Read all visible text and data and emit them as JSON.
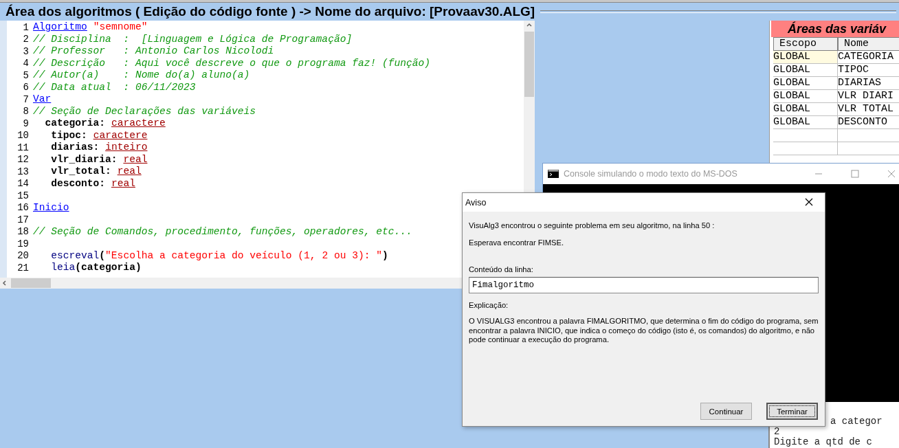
{
  "editor": {
    "title": "Área dos algoritmos ( Edição do código fonte ) -> Nome do arquivo: [Provaav30.ALG]",
    "lines": [
      {
        "number": "1",
        "tokens": [
          {
            "kind": "keyword",
            "text": "Algoritmo"
          },
          {
            "kind": "string",
            "text": "\"semnome\"",
            "gap": true
          }
        ]
      },
      {
        "number": "2",
        "tokens": [
          {
            "kind": "comment",
            "text": "// Disciplina  :  [Linguagem e Lógica de Programação]"
          }
        ]
      },
      {
        "number": "3",
        "tokens": [
          {
            "kind": "comment",
            "text": "// Professor   : Antonio Carlos Nicolodi"
          }
        ]
      },
      {
        "number": "4",
        "tokens": [
          {
            "kind": "comment",
            "text": "// Descrição   : Aqui você descreve o que o programa faz! (função)"
          }
        ]
      },
      {
        "number": "5",
        "tokens": [
          {
            "kind": "comment",
            "text": "// Autor(a)    : Nome do(a) aluno(a)"
          }
        ]
      },
      {
        "number": "6",
        "tokens": [
          {
            "kind": "comment",
            "text": "// Data atual  : 06/11/2023"
          }
        ]
      },
      {
        "number": "7",
        "tokens": [
          {
            "kind": "keyword",
            "text": "Var"
          }
        ]
      },
      {
        "number": "8",
        "tokens": [
          {
            "kind": "comment",
            "text": "// Seção de Declarações das variáveis"
          }
        ]
      },
      {
        "number": "9",
        "tokens": [
          {
            "kind": "ident",
            "text": "  categoria:"
          },
          {
            "kind": "type",
            "text": "caractere",
            "gap": true
          }
        ]
      },
      {
        "number": "10",
        "tokens": [
          {
            "kind": "ident",
            "text": "   tipoc:"
          },
          {
            "kind": "type",
            "text": "caractere",
            "gap": true
          }
        ]
      },
      {
        "number": "11",
        "tokens": [
          {
            "kind": "ident",
            "text": "   diarias:"
          },
          {
            "kind": "type",
            "text": "inteiro",
            "gap": true
          }
        ]
      },
      {
        "number": "12",
        "tokens": [
          {
            "kind": "ident",
            "text": "   vlr_diaria:"
          },
          {
            "kind": "type",
            "text": "real",
            "gap": true
          }
        ]
      },
      {
        "number": "13",
        "tokens": [
          {
            "kind": "ident",
            "text": "   vlr_total:"
          },
          {
            "kind": "type",
            "text": "real",
            "gap": true
          }
        ]
      },
      {
        "number": "14",
        "tokens": [
          {
            "kind": "ident",
            "text": "   desconto:"
          },
          {
            "kind": "type",
            "text": "real",
            "gap": true
          }
        ]
      },
      {
        "number": "15"
      },
      {
        "number": "16",
        "tokens": [
          {
            "kind": "keyword",
            "text": "Inicio"
          }
        ]
      },
      {
        "number": "17"
      },
      {
        "number": "18",
        "tokens": [
          {
            "kind": "comment",
            "text": "// Seção de Comandos, procedimento, funções, operadores, etc..."
          }
        ]
      },
      {
        "number": "19"
      },
      {
        "number": "20",
        "tokens": [
          {
            "kind": "builtin",
            "text": "   escreval"
          },
          {
            "kind": "ident",
            "text": "("
          },
          {
            "kind": "string",
            "text": "\"Escolha a categoria do veículo (1, 2 ou 3): \""
          },
          {
            "kind": "ident",
            "text": ")"
          }
        ]
      },
      {
        "number": "21",
        "tokens": [
          {
            "kind": "builtin",
            "text": "   leia"
          },
          {
            "kind": "ident",
            "text": "(categoria)"
          }
        ]
      }
    ]
  },
  "variables": {
    "title": "Áreas das variáv",
    "columns": [
      "Escopo",
      "Nome"
    ],
    "rows": [
      {
        "cells": [
          "GLOBAL",
          "CATEGORIA"
        ],
        "selected": true
      },
      {
        "cells": [
          "GLOBAL",
          "TIPOC"
        ],
        "selected": false
      },
      {
        "cells": [
          "GLOBAL",
          "DIARIAS"
        ],
        "selected": false
      },
      {
        "cells": [
          "GLOBAL",
          "VLR DIARI"
        ],
        "selected": false
      },
      {
        "cells": [
          "GLOBAL",
          "VLR TOTAL"
        ],
        "selected": false
      },
      {
        "cells": [
          "GLOBAL",
          "DESCONTO"
        ],
        "selected": false
      }
    ]
  },
  "console": {
    "title": "Console simulando o modo texto do MS-DOS"
  },
  "output": [
    {
      "text": "a categor",
      "clipped_left": true
    },
    {
      "text": "2",
      "clipped_left": false
    },
    {
      "text": "Digite a qtd de c",
      "clipped_left": false
    }
  ],
  "dialog": {
    "title": "Aviso",
    "message": "VisuAlg3 encontrou o seguinte problema em seu algoritmo, na linha 50 :",
    "problem": "Esperava encontrar FIMSE.",
    "line_label": "Conteúdo da linha:",
    "line_value": "Fimalgoritmo",
    "explanation_label": "Explicação:",
    "explanation": "O VISUALG3 encontrou a palavra FIMALGORITMO, que determina o fim do código do programa, sem encontrar a palavra INICIO, que indica o começo do código (isto é, os comandos) do algoritmo, e não pode continuar a execução do programa.",
    "buttons": [
      {
        "label": "Continuar",
        "focused": false
      },
      {
        "label": "Terminar",
        "focused": true
      }
    ]
  }
}
